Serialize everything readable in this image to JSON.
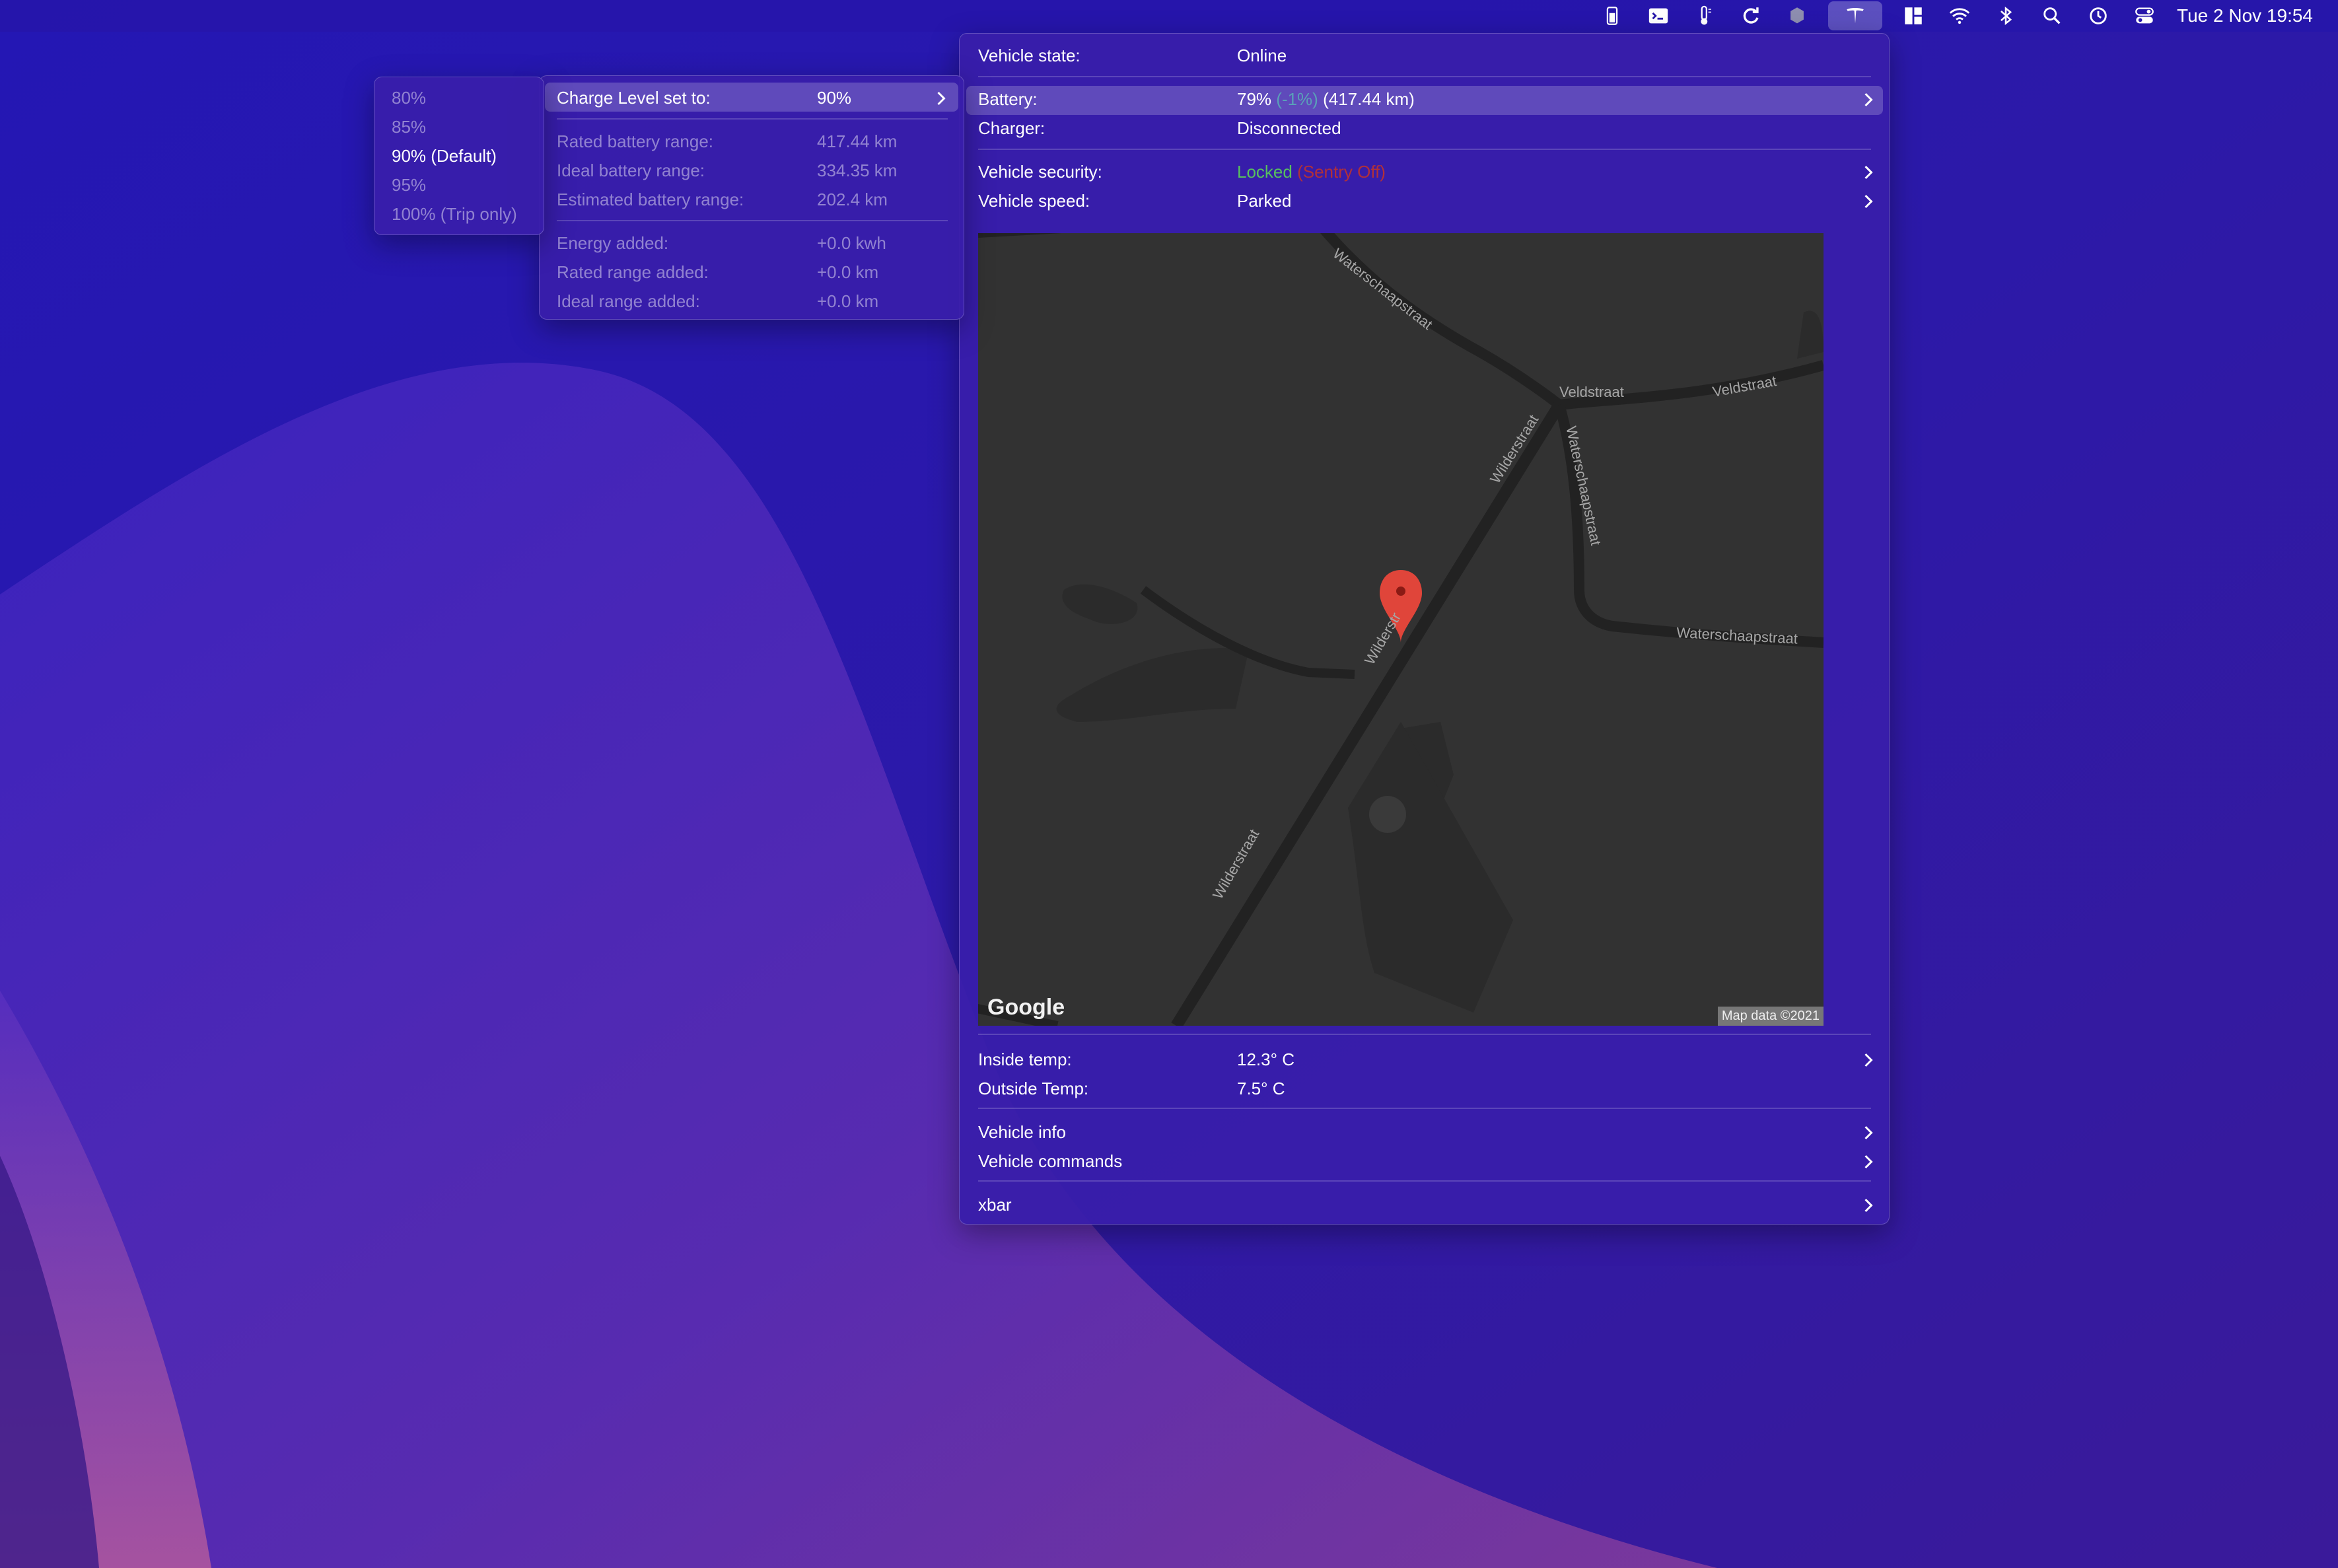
{
  "menubar": {
    "icons": [
      "battery-widget-icon",
      "terminal-icon",
      "thermometer-icon",
      "refresh-icon",
      "hexagon-icon",
      "tesla-icon",
      "layout-icon",
      "wifi-icon",
      "bluetooth-icon",
      "search-icon",
      "time-machine-icon",
      "control-center-icon"
    ],
    "active_icon": "tesla-icon",
    "clock": "Tue 2 Nov  19:54"
  },
  "main_menu": {
    "vehicle_state_label": "Vehicle state:",
    "vehicle_state_value": "Online",
    "battery_label": "Battery:",
    "battery_percent": "79%",
    "battery_change": "(-1%)",
    "battery_range": "(417.44 km)",
    "charger_label": "Charger:",
    "charger_value": "Disconnected",
    "security_label": "Vehicle security:",
    "security_locked": "Locked",
    "security_sentry": "(Sentry Off)",
    "speed_label": "Vehicle speed:",
    "speed_value": "Parked",
    "map": {
      "roads": [
        "Waterschaapstraat",
        "Veldstraat",
        "Veldstraat",
        "Wilderstraat",
        "Waterschaapstraat",
        "Waterschaapstraat",
        "Wilderstr",
        "Wilderstraat"
      ],
      "logo": "Google",
      "attribution": "Map data ©2021",
      "pin_color": "#e0453a"
    },
    "inside_temp_label": "Inside temp:",
    "inside_temp_value": "12.3° C",
    "outside_temp_label": "Outside Temp:",
    "outside_temp_value": "7.5° C",
    "vehicle_info": "Vehicle info",
    "vehicle_commands": "Vehicle commands",
    "xbar": "xbar"
  },
  "charge_submenu": {
    "charge_level_label": "Charge Level set to:",
    "charge_level_value": "90%",
    "rated_range_label": "Rated battery range:",
    "rated_range_value": "417.44 km",
    "ideal_range_label": "Ideal battery range:",
    "ideal_range_value": "334.35 km",
    "estimated_range_label": "Estimated battery range:",
    "estimated_range_value": "202.4 km",
    "energy_added_label": "Energy added:",
    "energy_added_value": "+0.0 kwh",
    "rated_added_label": "Rated range added:",
    "rated_added_value": "+0.0 km",
    "ideal_added_label": "Ideal range added:",
    "ideal_added_value": "+0.0 km"
  },
  "level_submenu": {
    "options": [
      "80%",
      "85%",
      "90% (Default)",
      "95%",
      "100% (Trip only)"
    ],
    "selected_index": 2
  },
  "colors": {
    "menu_bg": "#381eaa",
    "green": "#57c05e",
    "red": "#b0303a",
    "teal": "#5aa0b8"
  }
}
